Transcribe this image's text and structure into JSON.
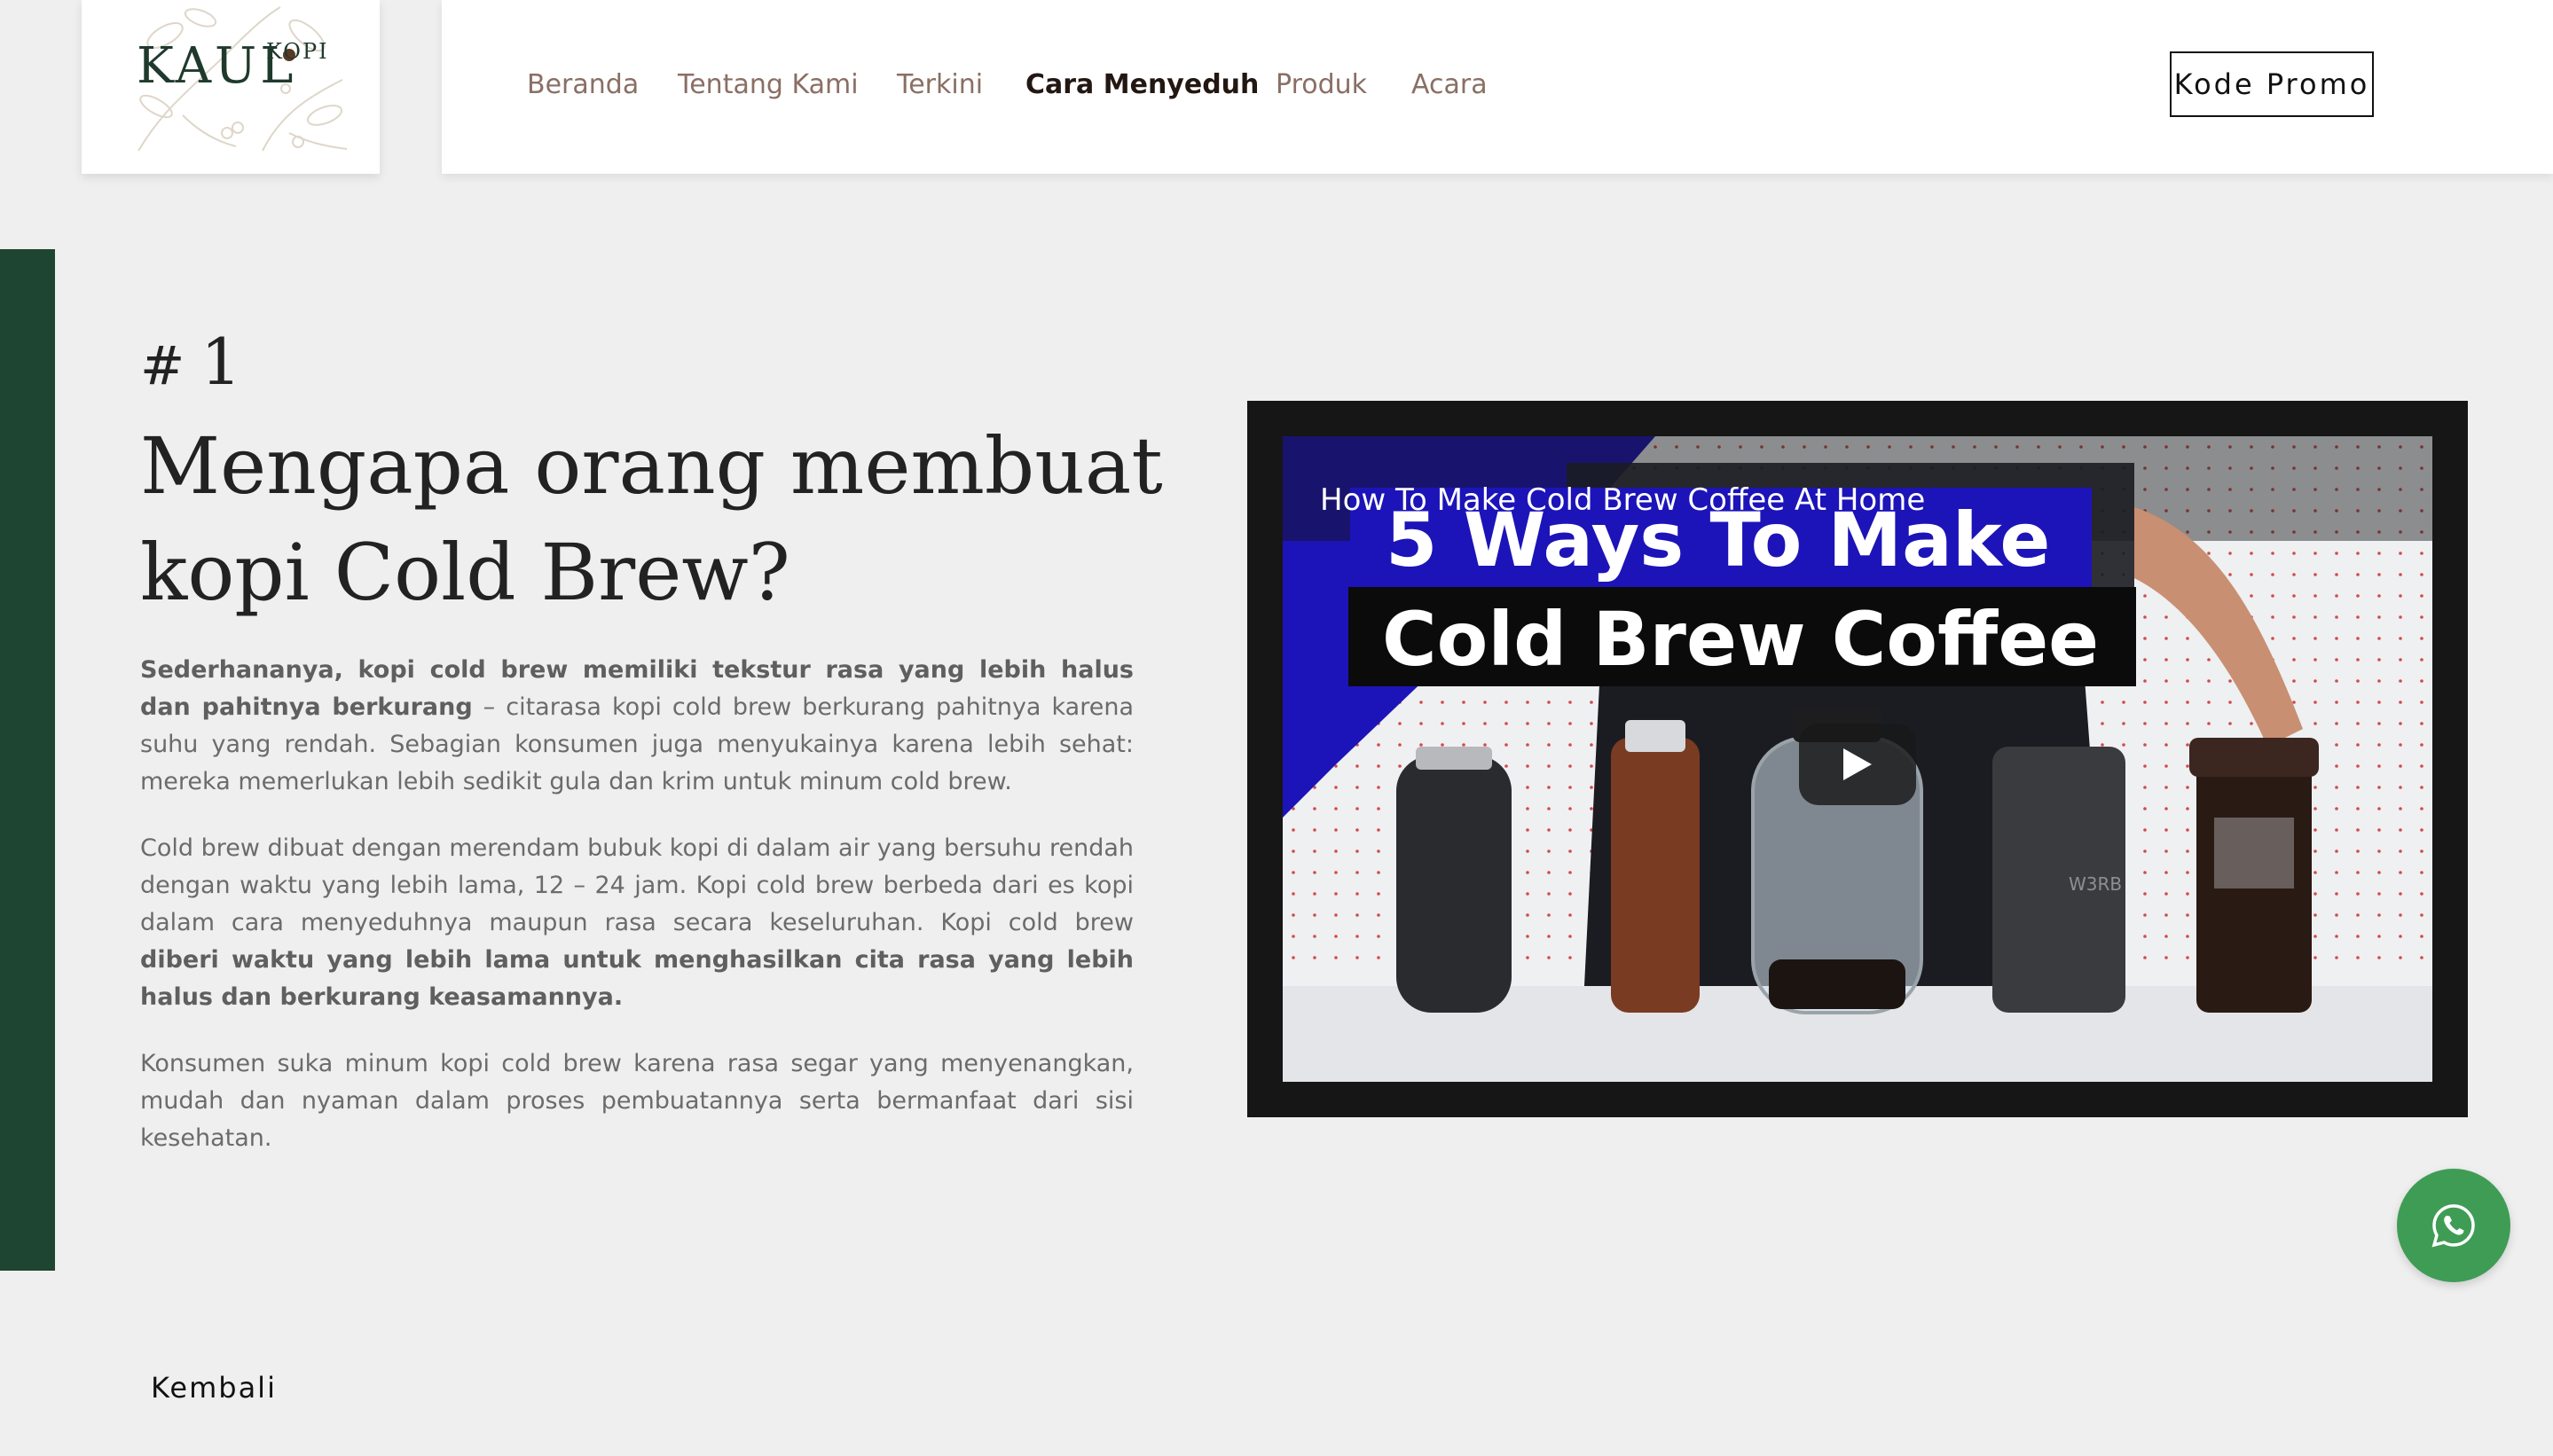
{
  "header": {
    "logo": {
      "text": "KAUL",
      "sup": "KOPI"
    },
    "nav": [
      {
        "label": "Beranda",
        "active": false
      },
      {
        "label": "Tentang Kami",
        "active": false
      },
      {
        "label": "Terkini",
        "active": false
      },
      {
        "label": "Cara Menyeduh",
        "active": true
      },
      {
        "label": "Produk",
        "active": false
      },
      {
        "label": "Acara",
        "active": false
      }
    ],
    "promo_button": "Kode Promo"
  },
  "article": {
    "step_hash": "#",
    "step_number": "1",
    "title": "Mengapa orang membuat kopi Cold Brew?",
    "paragraphs": [
      {
        "bold_lead": "Sederhananya, kopi cold brew memiliki tekstur rasa yang lebih halus dan pahitnya berkurang",
        "text": " – citarasa kopi cold brew berkurang pahitnya karena suhu yang rendah. Sebagian konsumen juga menyukainya karena lebih sehat: mereka memerlukan lebih sedikit gula dan krim untuk minum cold brew."
      },
      {
        "text": "Cold brew dibuat dengan merendam bubuk kopi di dalam air yang bersuhu rendah dengan waktu yang lebih lama, 12 – 24 jam. Kopi cold brew berbeda dari es kopi dalam cara menyeduhnya maupun rasa secara keseluruhan. Kopi cold brew ",
        "bold_tail": "diberi waktu yang lebih lama untuk menghasilkan cita rasa yang lebih halus dan berkurang keasamannya."
      },
      {
        "text": "Konsumen suka minum kopi cold brew karena rasa segar yang menyenangkan, mudah dan nyaman dalam proses pembuatannya serta bermanfaat dari sisi kesehatan."
      }
    ]
  },
  "video": {
    "title": "How To Make Cold Brew Coffee At Home",
    "thumb_line1": "5 Ways To Make",
    "thumb_line2": "Cold Brew Coffee",
    "thumb_bottle_text": "W3RB"
  },
  "whatsapp": {
    "icon": "whatsapp-icon"
  },
  "footer": {
    "back_label": "Kembali"
  },
  "colors": {
    "accent_green": "#1d4532",
    "whatsapp_green": "#3f9c55",
    "nav_text": "#8a6f64",
    "nav_active": "#231712",
    "video_frame": "#161616",
    "thumb_blue": "#1c14b8"
  }
}
